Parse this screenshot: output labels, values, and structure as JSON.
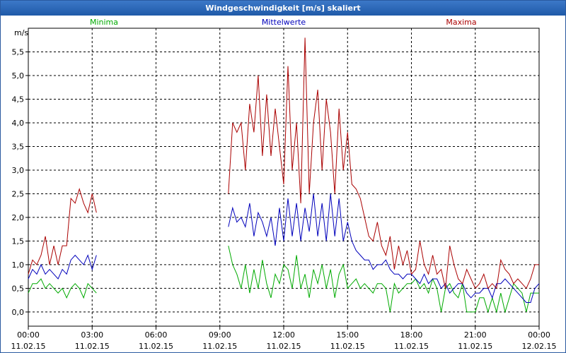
{
  "chart_data": {
    "type": "line",
    "title": "Windgeschwindigkeit [m/s] skaliert",
    "ylabel": "m/s",
    "ylim": [
      -0.3,
      6.0
    ],
    "y_ticks": [
      "0,0",
      "0,5",
      "1,0",
      "1,5",
      "2,0",
      "2,5",
      "3,0",
      "3,5",
      "4,0",
      "4,5",
      "5,0",
      "5,5"
    ],
    "y_tick_values": [
      0,
      0.5,
      1,
      1.5,
      2,
      2.5,
      3,
      3.5,
      4,
      4.5,
      5,
      5.5
    ],
    "x_ticks": [
      {
        "time": "00:00",
        "date": "11.02.15"
      },
      {
        "time": "03:00",
        "date": "11.02.15"
      },
      {
        "time": "06:00",
        "date": "11.02.15"
      },
      {
        "time": "09:00",
        "date": "11.02.15"
      },
      {
        "time": "12:00",
        "date": "11.02.15"
      },
      {
        "time": "15:00",
        "date": "11.02.15"
      },
      {
        "time": "18:00",
        "date": "11.02.15"
      },
      {
        "time": "21:00",
        "date": "11.02.15"
      },
      {
        "time": "00:00",
        "date": "12.02.15"
      }
    ],
    "x_unit": "hours since 11.02.15 00:00",
    "grid": true,
    "series": [
      {
        "name": "Minima",
        "color": "#00aa00",
        "segments": [
          {
            "x": [
              0,
              0.2,
              0.4,
              0.6,
              0.8,
              1.0,
              1.2,
              1.4,
              1.6,
              1.8,
              2.0,
              2.2,
              2.4,
              2.6,
              2.8,
              3.0,
              3.2
            ],
            "y": [
              0.4,
              0.6,
              0.6,
              0.7,
              0.5,
              0.6,
              0.5,
              0.4,
              0.5,
              0.3,
              0.5,
              0.6,
              0.5,
              0.3,
              0.6,
              0.5,
              0.4
            ]
          },
          {
            "x": [
              9.4,
              9.6,
              9.8,
              10.0,
              10.2,
              10.4,
              10.6,
              10.8,
              11.0,
              11.2,
              11.4,
              11.6,
              11.8,
              12.0,
              12.2,
              12.4,
              12.6,
              12.8,
              13.0,
              13.2,
              13.4,
              13.6,
              13.8,
              14.0,
              14.2,
              14.4,
              14.6,
              14.8,
              15.0,
              15.2,
              15.4,
              15.6,
              15.8,
              16.0,
              16.2,
              16.4,
              16.6,
              16.8,
              17.0,
              17.2,
              17.4,
              17.6,
              17.8,
              18.0,
              18.2,
              18.4,
              18.6,
              18.8,
              19.0,
              19.2,
              19.4,
              19.6,
              19.8,
              20.0,
              20.2,
              20.4,
              20.6,
              20.8,
              21.0,
              21.2,
              21.4,
              21.6,
              21.8,
              22.0,
              22.2,
              22.4,
              22.6,
              22.8,
              23.0,
              23.2,
              23.4,
              23.6,
              23.8,
              24.0
            ],
            "y": [
              1.4,
              1.0,
              0.8,
              0.5,
              1.0,
              0.4,
              0.9,
              0.5,
              1.1,
              0.6,
              0.3,
              0.8,
              0.6,
              1.0,
              0.9,
              0.5,
              1.2,
              0.5,
              0.8,
              0.3,
              0.9,
              0.6,
              1.0,
              0.5,
              0.9,
              0.3,
              0.8,
              1.0,
              0.5,
              0.6,
              0.7,
              0.5,
              0.6,
              0.5,
              0.4,
              0.6,
              0.6,
              0.5,
              0.0,
              0.6,
              0.4,
              0.5,
              0.6,
              0.6,
              0.7,
              0.5,
              0.6,
              0.4,
              0.7,
              0.5,
              0.0,
              0.5,
              0.6,
              0.4,
              0.3,
              0.6,
              0.0,
              0.0,
              0.0,
              0.3,
              0.3,
              0.0,
              0.3,
              0.0,
              0.4,
              0.0,
              0.3,
              0.6,
              0.5,
              0.4,
              0.0,
              0.4,
              0.4,
              0.4
            ]
          }
        ]
      },
      {
        "name": "Mittelwerte",
        "color": "#0000bb",
        "segments": [
          {
            "x": [
              0,
              0.2,
              0.4,
              0.6,
              0.8,
              1.0,
              1.2,
              1.4,
              1.6,
              1.8,
              2.0,
              2.2,
              2.4,
              2.6,
              2.8,
              3.0,
              3.2
            ],
            "y": [
              0.7,
              0.9,
              0.8,
              1.0,
              0.8,
              0.9,
              0.8,
              0.7,
              0.9,
              0.8,
              1.1,
              1.2,
              1.1,
              1.0,
              1.2,
              0.9,
              1.2
            ]
          },
          {
            "x": [
              9.4,
              9.6,
              9.8,
              10.0,
              10.2,
              10.4,
              10.6,
              10.8,
              11.0,
              11.2,
              11.4,
              11.6,
              11.8,
              12.0,
              12.2,
              12.4,
              12.6,
              12.8,
              13.0,
              13.2,
              13.4,
              13.6,
              13.8,
              14.0,
              14.2,
              14.4,
              14.6,
              14.8,
              15.0,
              15.2,
              15.4,
              15.6,
              15.8,
              16.0,
              16.2,
              16.4,
              16.6,
              16.8,
              17.0,
              17.2,
              17.4,
              17.6,
              17.8,
              18.0,
              18.2,
              18.4,
              18.6,
              18.8,
              19.0,
              19.2,
              19.4,
              19.6,
              19.8,
              20.0,
              20.2,
              20.4,
              20.6,
              20.8,
              21.0,
              21.2,
              21.4,
              21.6,
              21.8,
              22.0,
              22.2,
              22.4,
              22.6,
              22.8,
              23.0,
              23.2,
              23.4,
              23.6,
              23.8,
              24.0
            ],
            "y": [
              1.8,
              2.2,
              1.9,
              2.0,
              1.8,
              2.3,
              1.6,
              2.1,
              1.9,
              1.6,
              2.0,
              1.4,
              2.2,
              1.5,
              2.4,
              1.6,
              2.3,
              1.5,
              2.2,
              1.7,
              2.5,
              1.6,
              2.3,
              1.5,
              2.5,
              1.6,
              2.4,
              1.5,
              1.9,
              1.5,
              1.3,
              1.2,
              1.1,
              1.1,
              0.9,
              1.0,
              1.0,
              1.1,
              0.9,
              0.8,
              0.8,
              0.7,
              0.8,
              0.8,
              0.7,
              0.6,
              0.8,
              0.6,
              0.7,
              0.7,
              0.5,
              0.6,
              0.4,
              0.5,
              0.6,
              0.6,
              0.4,
              0.3,
              0.4,
              0.4,
              0.5,
              0.5,
              0.3,
              0.6,
              0.6,
              0.7,
              0.6,
              0.5,
              0.4,
              0.3,
              0.2,
              0.2,
              0.5,
              0.6
            ]
          }
        ]
      },
      {
        "name": "Maxima",
        "color": "#aa0000",
        "segments": [
          {
            "x": [
              0,
              0.2,
              0.4,
              0.6,
              0.8,
              1.0,
              1.2,
              1.4,
              1.6,
              1.8,
              2.0,
              2.2,
              2.4,
              2.6,
              2.8,
              3.0,
              3.2
            ],
            "y": [
              0.8,
              1.1,
              1.0,
              1.2,
              1.6,
              1.0,
              1.4,
              1.0,
              1.4,
              1.4,
              2.4,
              2.3,
              2.6,
              2.3,
              2.1,
              2.5,
              2.1
            ]
          },
          {
            "x": [
              9.4,
              9.6,
              9.8,
              10.0,
              10.2,
              10.4,
              10.6,
              10.8,
              11.0,
              11.2,
              11.4,
              11.6,
              11.8,
              12.0,
              12.2,
              12.4,
              12.6,
              12.8,
              13.0,
              13.2,
              13.4,
              13.6,
              13.8,
              14.0,
              14.2,
              14.4,
              14.6,
              14.8,
              15.0,
              15.2,
              15.4,
              15.6,
              15.8,
              16.0,
              16.2,
              16.4,
              16.6,
              16.8,
              17.0,
              17.2,
              17.4,
              17.6,
              17.8,
              18.0,
              18.2,
              18.4,
              18.6,
              18.8,
              19.0,
              19.2,
              19.4,
              19.6,
              19.8,
              20.0,
              20.2,
              20.4,
              20.6,
              20.8,
              21.0,
              21.2,
              21.4,
              21.6,
              21.8,
              22.0,
              22.2,
              22.4,
              22.6,
              22.8,
              23.0,
              23.2,
              23.4,
              23.6,
              23.8,
              24.0
            ],
            "y": [
              2.5,
              4.0,
              3.8,
              4.0,
              3.0,
              4.4,
              3.8,
              5.0,
              3.3,
              4.6,
              3.3,
              4.3,
              3.5,
              2.7,
              5.2,
              3.0,
              4.0,
              2.3,
              5.8,
              2.5,
              4.0,
              4.7,
              3.0,
              4.5,
              3.8,
              2.5,
              4.3,
              3.0,
              3.8,
              2.7,
              2.6,
              2.4,
              2.0,
              1.6,
              1.5,
              1.9,
              1.4,
              1.2,
              1.6,
              0.9,
              1.4,
              1.0,
              1.3,
              0.8,
              0.9,
              1.5,
              1.0,
              0.8,
              1.2,
              0.8,
              0.9,
              0.5,
              1.4,
              1.0,
              0.7,
              0.6,
              0.9,
              0.7,
              0.5,
              0.6,
              0.8,
              0.5,
              0.6,
              0.5,
              1.1,
              0.9,
              0.8,
              0.6,
              0.7,
              0.6,
              0.5,
              0.7,
              1.0,
              1.0
            ]
          }
        ]
      }
    ]
  }
}
